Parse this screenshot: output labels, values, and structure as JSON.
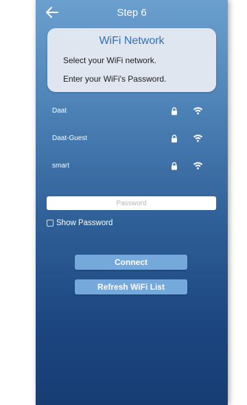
{
  "header": {
    "title": "Step 6",
    "back_icon": "arrow-left-icon"
  },
  "info_card": {
    "title": "WiFi Network",
    "line1": "Select your WiFi network.",
    "line2": "Enter your WiFi's Password."
  },
  "networks": [
    {
      "name": "Daat",
      "secured": true,
      "lock_icon": "lock-icon",
      "signal_icon": "wifi-icon"
    },
    {
      "name": "Daat-Guest",
      "secured": true,
      "lock_icon": "lock-icon",
      "signal_icon": "wifi-icon"
    },
    {
      "name": "smart",
      "secured": true,
      "lock_icon": "lock-icon",
      "signal_icon": "wifi-icon"
    }
  ],
  "password": {
    "value": "",
    "placeholder": "Password"
  },
  "show_password": {
    "label": "Show Password",
    "checked": false
  },
  "buttons": {
    "connect": "Connect",
    "refresh": "Refresh WiFi List"
  },
  "colors": {
    "card_title": "#2e6fb8",
    "button_bg": "#76a9db",
    "gradient_top": "#6a9fce",
    "gradient_bottom": "#173d74"
  }
}
